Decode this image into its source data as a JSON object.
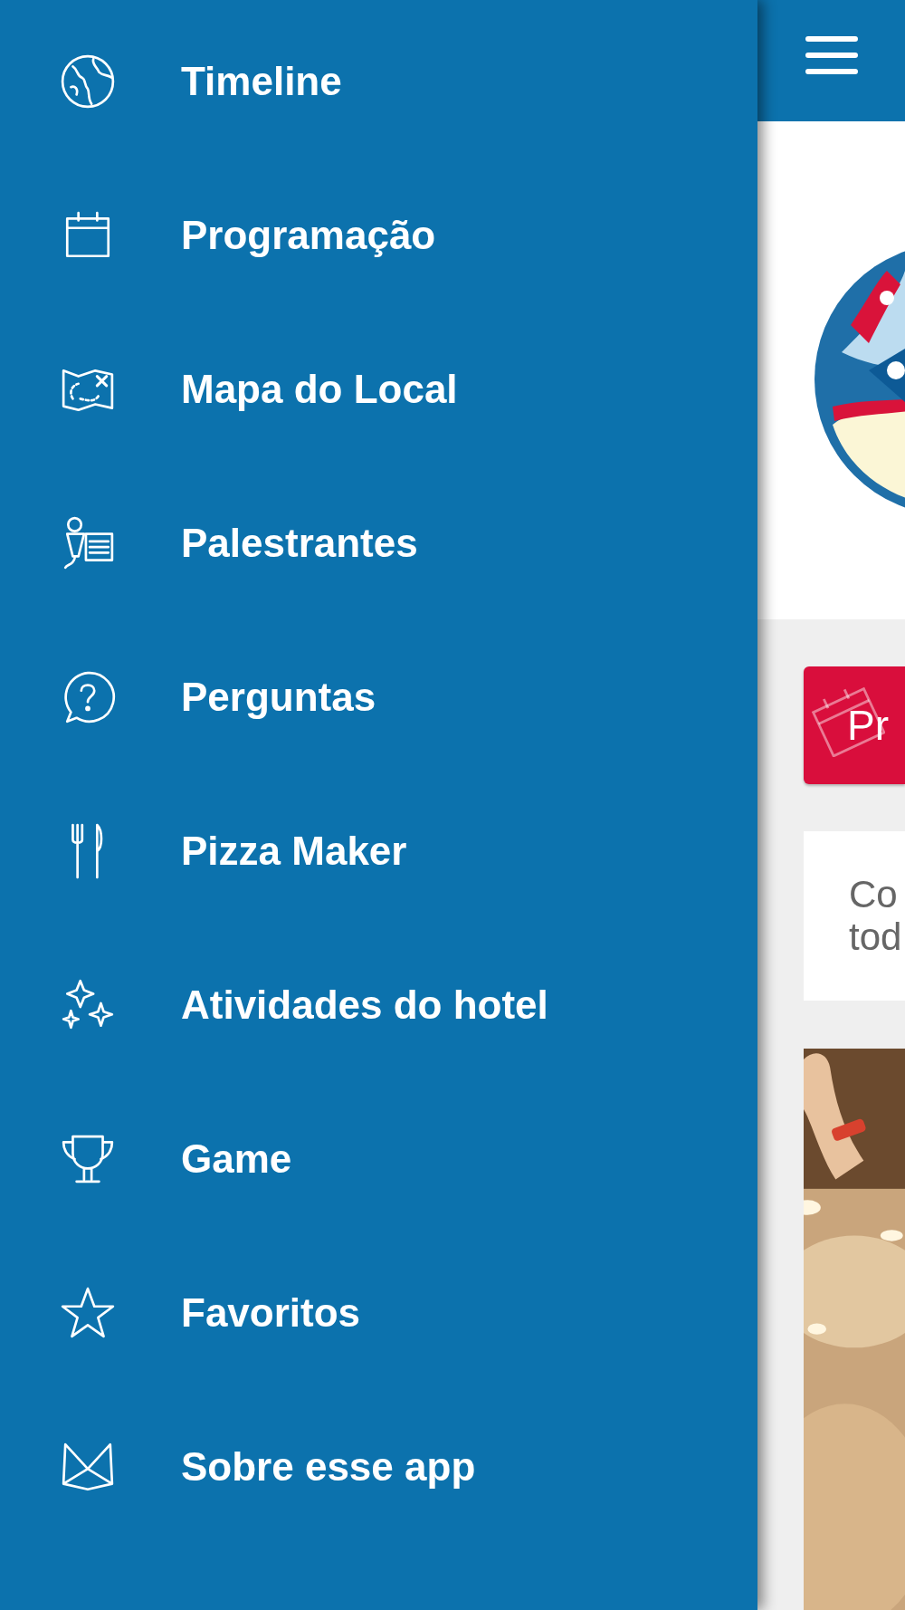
{
  "menu": {
    "items": [
      {
        "label": "Timeline"
      },
      {
        "label": "Programação"
      },
      {
        "label": "Mapa do Local"
      },
      {
        "label": "Palestrantes"
      },
      {
        "label": "Perguntas"
      },
      {
        "label": "Pizza Maker"
      },
      {
        "label": "Atividades do hotel"
      },
      {
        "label": "Game"
      },
      {
        "label": "Favoritos"
      },
      {
        "label": "Sobre esse app"
      }
    ]
  },
  "content": {
    "button": {
      "label": "Pr"
    },
    "card": {
      "lines": [
        "Co",
        "tod"
      ]
    }
  }
}
